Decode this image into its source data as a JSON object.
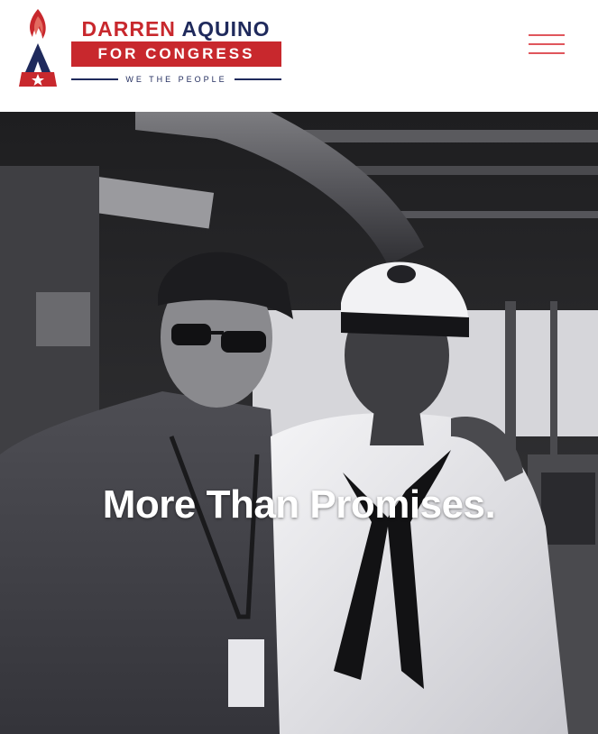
{
  "header": {
    "logo": {
      "first_name": "DARREN",
      "last_name": "AQUINO",
      "banner": "FOR CONGRESS",
      "tagline": "WE THE PEOPLE",
      "colors": {
        "red": "#c8282d",
        "navy": "#1f2a5c"
      },
      "icon": "flame-star-a-icon"
    },
    "menu": {
      "icon": "hamburger-menu-icon",
      "color": "#e0565c"
    }
  },
  "hero": {
    "headline": "More Than Promises.",
    "image": "photo-man-and-navy-sailor-on-ship-bridge"
  }
}
